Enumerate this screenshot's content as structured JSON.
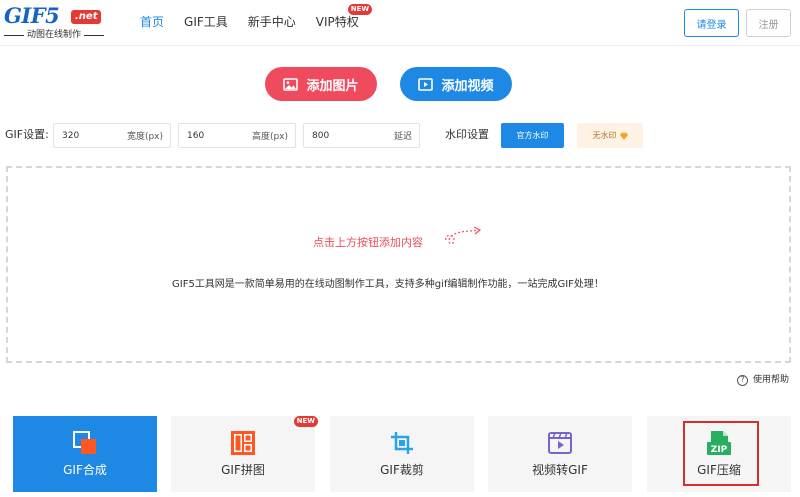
{
  "header": {
    "logo_text": "GIF5",
    "logo_suffix": ".net",
    "logo_subtitle": "动图在线制作",
    "nav": [
      {
        "label": "首页",
        "active": true
      },
      {
        "label": "GIF工具",
        "active": false
      },
      {
        "label": "新手中心",
        "active": false
      },
      {
        "label": "VIP特权",
        "active": false,
        "badge": "NEW"
      }
    ],
    "login_label": "请登录",
    "register_label": "注册"
  },
  "upload": {
    "add_image_label": "添加图片",
    "add_video_label": "添加视频"
  },
  "settings": {
    "label": "GIF设置:",
    "width_value": "320",
    "width_unit": "宽度(px)",
    "height_value": "160",
    "height_unit": "高度(px)",
    "delay_value": "800",
    "delay_unit": "延迟",
    "watermark_label": "水印设置",
    "official_watermark": "官方水印",
    "no_watermark": "无水印"
  },
  "dropzone": {
    "hint": "点击上方按钮添加内容",
    "description": "GIF5工具网是一款简单易用的在线动图制作工具，支持多种gif编辑制作功能，一站完成GIF处理！"
  },
  "help_label": "使用帮助",
  "tools": [
    {
      "label": "GIF合成",
      "icon": "merge-icon",
      "active": true
    },
    {
      "label": "GIF拼图",
      "icon": "collage-icon",
      "badge": "NEW"
    },
    {
      "label": "GIF裁剪",
      "icon": "crop-icon"
    },
    {
      "label": "视频转GIF",
      "icon": "video-icon"
    },
    {
      "label": "GIF压缩",
      "icon": "zip-icon",
      "icon_text": "ZIP"
    }
  ],
  "colors": {
    "primary": "#1e88e5",
    "accent_red": "#f04a5f",
    "zip_green": "#27ae60",
    "highlight": "#d32f2f"
  }
}
